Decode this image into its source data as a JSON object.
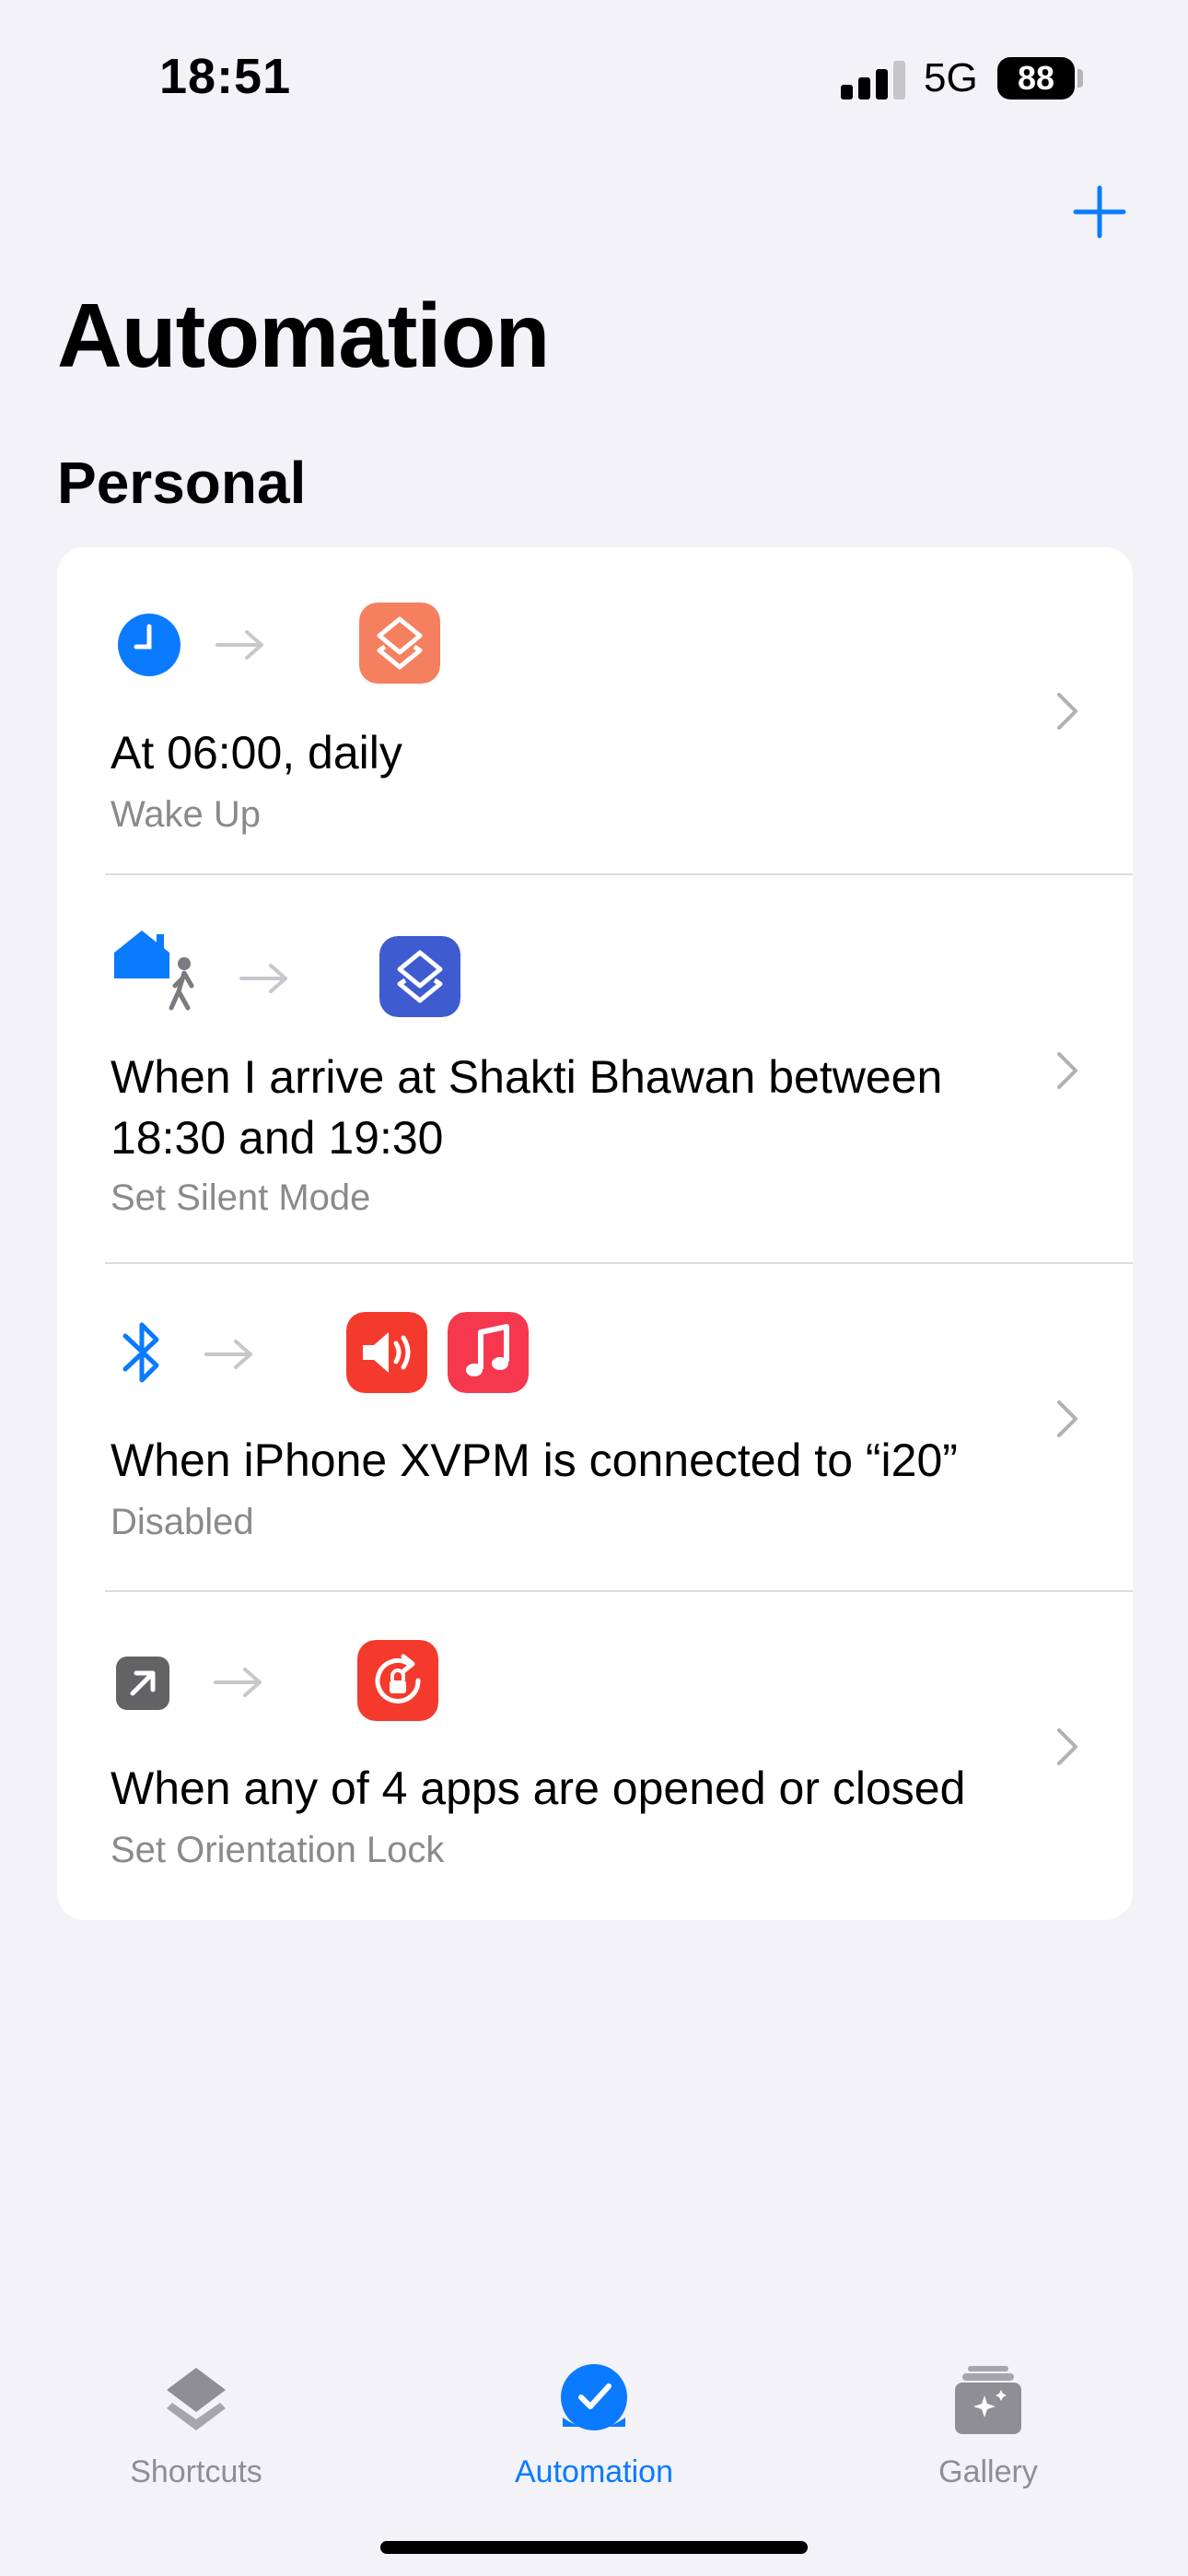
{
  "status_bar": {
    "time": "18:51",
    "network": "5G",
    "battery": "88"
  },
  "header": {
    "title": "Automation",
    "add_icon": "plus-icon"
  },
  "section": {
    "title": "Personal"
  },
  "automations": [
    {
      "trigger_icon": "clock-icon",
      "action_icons": [
        "shortcuts-app-icon"
      ],
      "title": "At 06:00, daily",
      "subtitle": "Wake Up"
    },
    {
      "trigger_icon": "home-arrive-icon",
      "action_icons": [
        "shortcuts-app-icon"
      ],
      "title": "When I arrive at Shakti Bhawan between 18:30 and 19:30",
      "subtitle": "Set Silent Mode"
    },
    {
      "trigger_icon": "bluetooth-icon",
      "action_icons": [
        "volume-app-icon",
        "music-app-icon"
      ],
      "title": "When iPhone XVPM is connected to “i20”",
      "subtitle": "Disabled"
    },
    {
      "trigger_icon": "app-open-icon",
      "action_icons": [
        "orientation-lock-icon"
      ],
      "title": "When any of 4 apps are opened or closed",
      "subtitle": "Set Orientation Lock"
    }
  ],
  "tabs": [
    {
      "label": "Shortcuts",
      "icon": "shortcuts-tab-icon",
      "active": false
    },
    {
      "label": "Automation",
      "icon": "automation-tab-icon",
      "active": true
    },
    {
      "label": "Gallery",
      "icon": "gallery-tab-icon",
      "active": false
    }
  ],
  "colors": {
    "accent": "#0a7aff",
    "background": "#f2f2f7",
    "secondary_text": "#8a8a8e"
  }
}
